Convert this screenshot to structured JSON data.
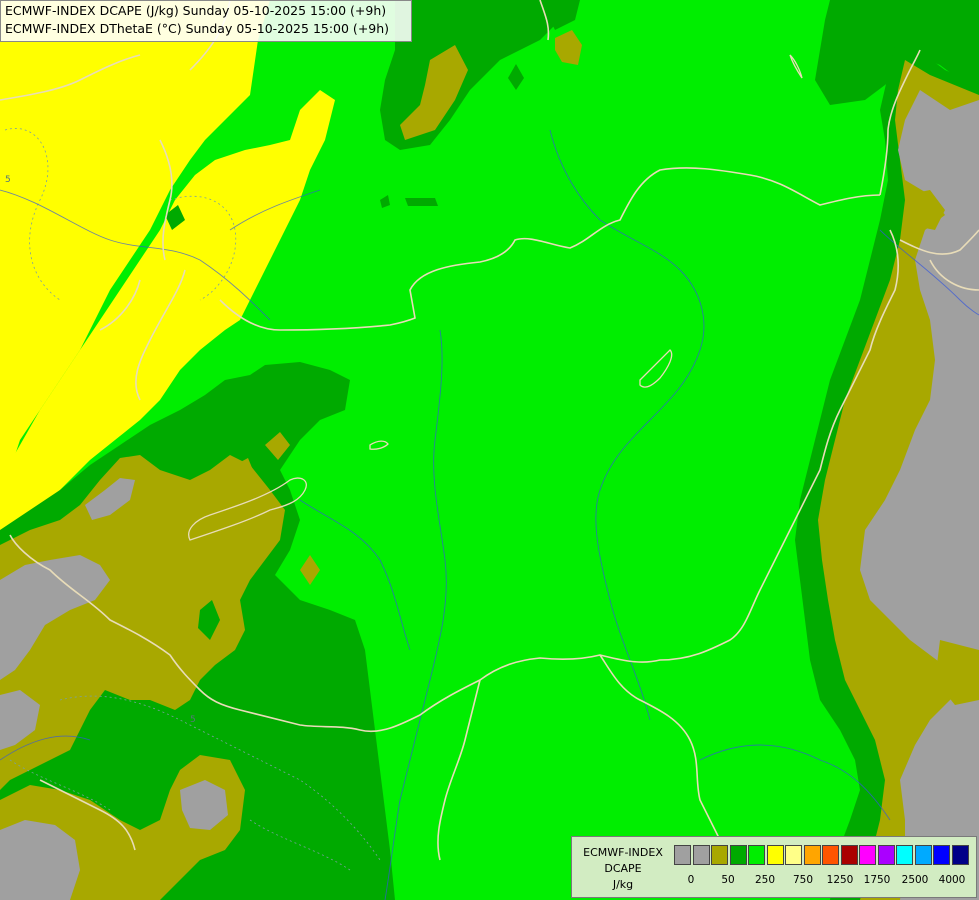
{
  "header": {
    "line1": "ECMWF-INDEX DCAPE (J/kg) Sunday 05-10-2025 15:00 (+9h)",
    "line2": "ECMWF-INDEX DThetaE (°C) Sunday 05-10-2025 15:00 (+9h)"
  },
  "map": {
    "contour_labels": [
      "5",
      "5"
    ],
    "fill_colors": {
      "below_0": "#a0a0a0",
      "0_50": "#a8a800",
      "50_250": "#00aa00",
      "250_500": "#00ee00",
      "500_750": "#ffff00"
    },
    "border_color": "#e8dcb8",
    "river_color": "#3355dd"
  },
  "legend": {
    "title_lines": [
      "ECMWF-INDEX",
      "DCAPE",
      "J/kg"
    ],
    "colors": [
      "#a0a0a0",
      "#a0a0a0",
      "#a8a800",
      "#00aa00",
      "#00ee00",
      "#ffff00",
      "#ffff88",
      "#ffa500",
      "#ff5500",
      "#aa0000",
      "#ff00ff",
      "#aa00ff",
      "#00ffff",
      "#00aaff",
      "#0000ff",
      "#000088"
    ],
    "tick_labels": [
      "0",
      "50",
      "250",
      "750",
      "1250",
      "1750",
      "2500",
      "4000"
    ]
  }
}
